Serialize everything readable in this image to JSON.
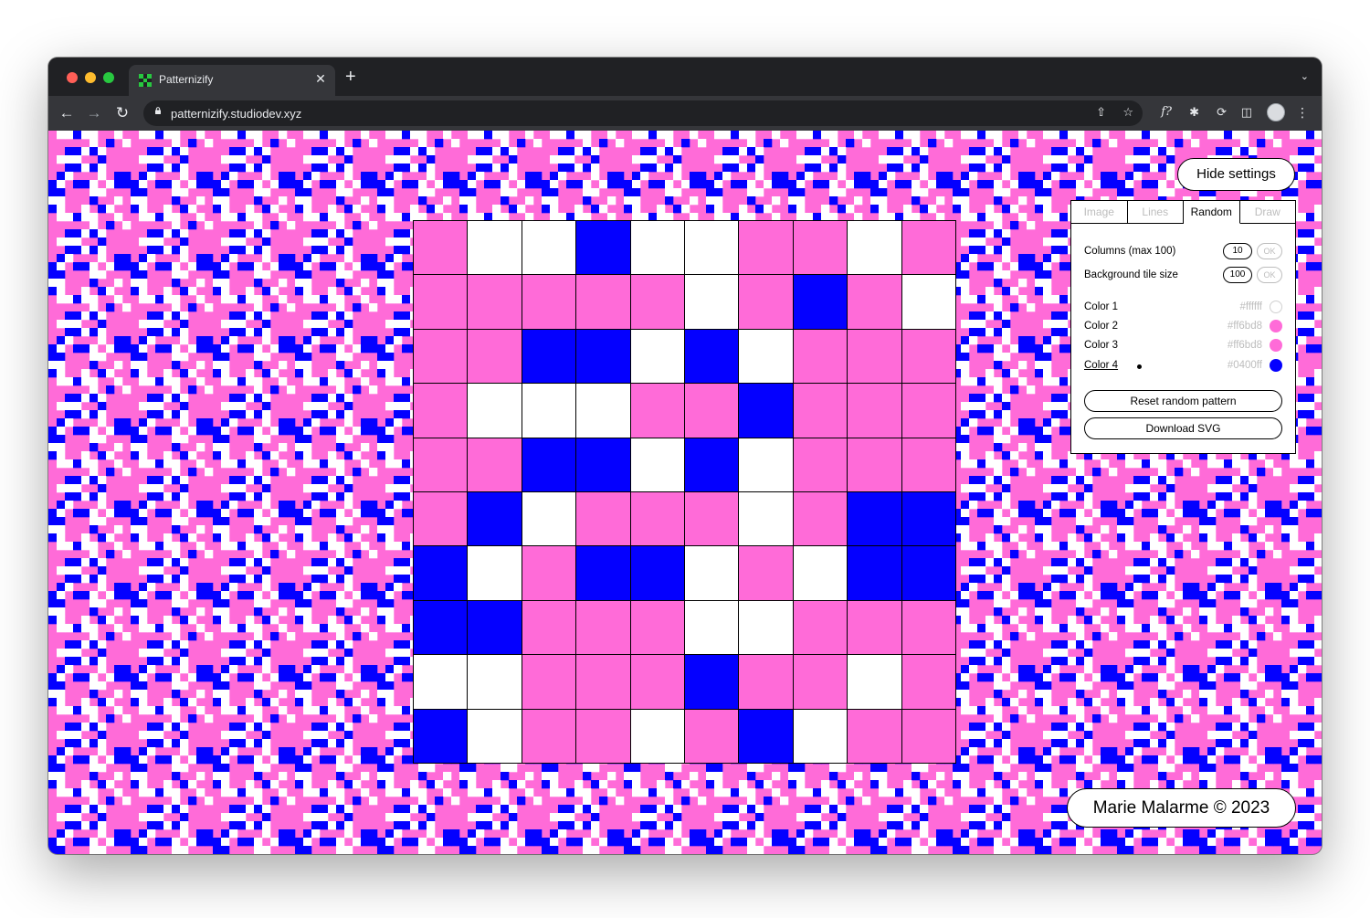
{
  "browser": {
    "tab_title": "Patternizify",
    "tab_close": "✕",
    "new_tab": "+",
    "url": "patternizify.studiodev.xyz",
    "ext_font_label": "f?"
  },
  "app": {
    "hide_settings_label": "Hide settings",
    "credit": "Marie Malarme © 2023"
  },
  "settings": {
    "tabs": [
      {
        "label": "Image",
        "active": false
      },
      {
        "label": "Lines",
        "active": false
      },
      {
        "label": "Random",
        "active": true
      },
      {
        "label": "Draw",
        "active": false
      }
    ],
    "columns_label": "Columns (max 100)",
    "columns_value": "10",
    "tile_size_label": "Background tile size",
    "tile_size_value": "100",
    "ok_label": "OK",
    "colors": [
      {
        "label": "Color 1",
        "hex": "#ffffff",
        "selected": false
      },
      {
        "label": "Color 2",
        "hex": "#ff6bd8",
        "selected": false
      },
      {
        "label": "Color 3",
        "hex": "#ff6bd8",
        "selected": false
      },
      {
        "label": "Color 4",
        "hex": "#0400ff",
        "selected": true
      }
    ],
    "reset_label": "Reset random pattern",
    "download_label": "Download SVG"
  },
  "palette": {
    "white": "#ffffff",
    "pink": "#ff6bd8",
    "blue": "#0400ff"
  },
  "pattern": {
    "legend": {
      "W": "white",
      "P": "pink",
      "B": "blue"
    },
    "rows": [
      "PWWBWWPPWP",
      "PPPPPWPBPW",
      "PPBBWBWPPP",
      "PWWWPPBPPP",
      "PPBBWBWPPP",
      "PBWPPPWPBB",
      "BWPBBWPWBB",
      "BBPPPWWPPP",
      "WWPPPBPPWP",
      "BWPPWPBWPP"
    ]
  }
}
